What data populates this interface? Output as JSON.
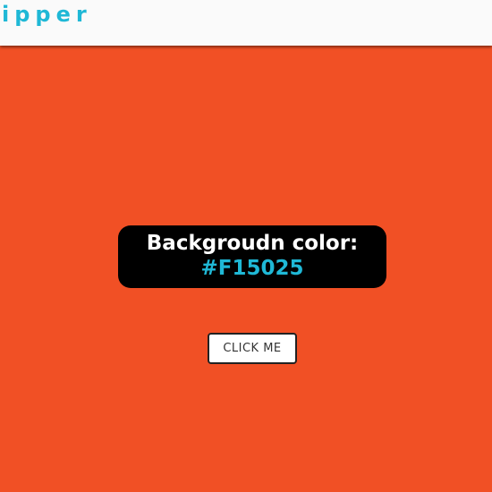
{
  "header": {
    "logo_text": "ipper"
  },
  "main": {
    "background_color": "#F15025",
    "color_label": "Backgroudn color:",
    "color_value": "#F15025",
    "button_label": "CLICK ME"
  },
  "colors": {
    "accent": "#1fb8d6",
    "topbar": "#fafafa",
    "box": "#000000"
  }
}
